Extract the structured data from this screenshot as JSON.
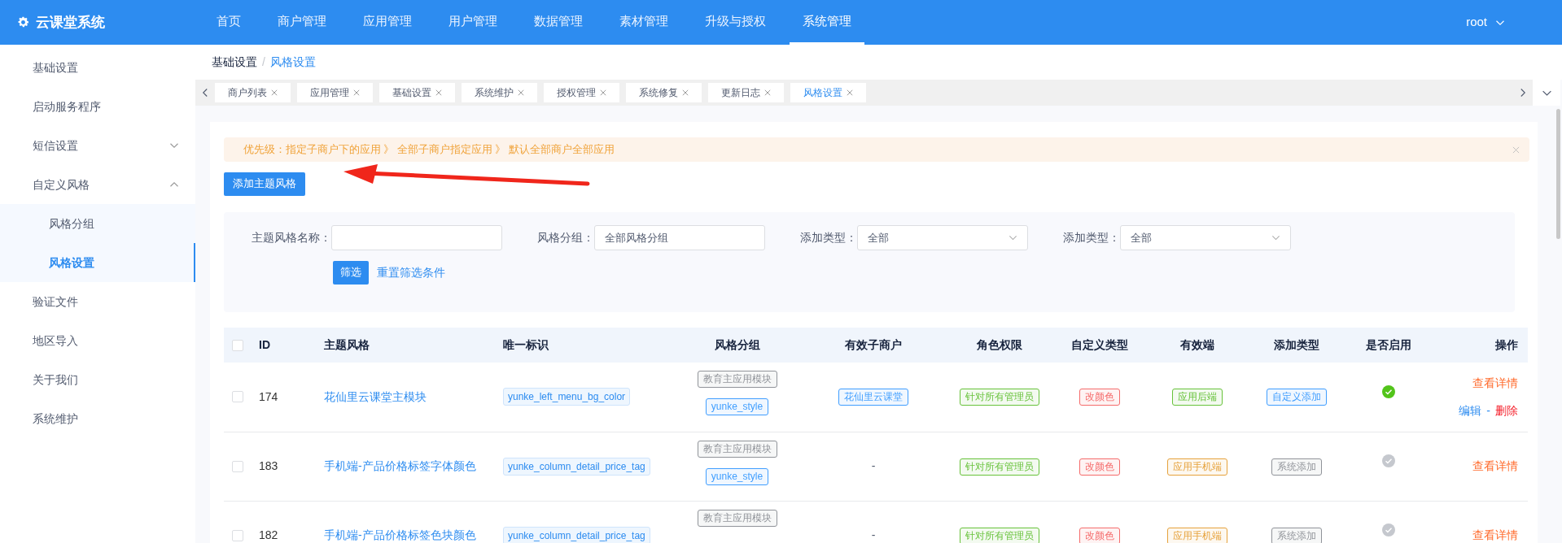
{
  "app": {
    "title": "云课堂系统",
    "user": "root"
  },
  "nav": [
    {
      "label": "首页",
      "selected": false
    },
    {
      "label": "商户管理",
      "selected": false
    },
    {
      "label": "应用管理",
      "selected": false
    },
    {
      "label": "用户管理",
      "selected": false
    },
    {
      "label": "数据管理",
      "selected": false
    },
    {
      "label": "素材管理",
      "selected": false
    },
    {
      "label": "升级与授权",
      "selected": false
    },
    {
      "label": "系统管理",
      "selected": true
    }
  ],
  "sidebar": [
    {
      "label": "基础设置",
      "selected": false
    },
    {
      "label": "启动服务程序",
      "selected": false
    },
    {
      "label": "短信设置",
      "selected": false,
      "expanded": false
    },
    {
      "label": "自定义风格",
      "selected": false,
      "expanded": true,
      "children": [
        {
          "label": "风格分组",
          "selected": false
        },
        {
          "label": "风格设置",
          "selected": true
        }
      ]
    },
    {
      "label": "验证文件",
      "selected": false
    },
    {
      "label": "地区导入",
      "selected": false
    },
    {
      "label": "关于我们",
      "selected": false
    },
    {
      "label": "系统维护",
      "selected": false
    }
  ],
  "breadcrumb": [
    {
      "label": "基础设置",
      "current": false
    },
    {
      "label": "风格设置",
      "current": true
    }
  ],
  "breadcrumb_separator": "/",
  "tabs": [
    {
      "label": "商户列表",
      "selected": false
    },
    {
      "label": "应用管理",
      "selected": false
    },
    {
      "label": "基础设置",
      "selected": false
    },
    {
      "label": "系统维护",
      "selected": false
    },
    {
      "label": "授权管理",
      "selected": false
    },
    {
      "label": "系统修复",
      "selected": false
    },
    {
      "label": "更新日志",
      "selected": false
    },
    {
      "label": "风格设置",
      "selected": true
    }
  ],
  "alert": "优先级：指定子商户下的应用 》 全部子商户指定应用 》 默认全部商户全部应用",
  "add_button": "添加主题风格",
  "filters": [
    {
      "label": "主题风格名称：",
      "kind": "input"
    },
    {
      "label": "风格分组：",
      "kind": "input",
      "value": "全部风格分组"
    },
    {
      "label": "添加类型：",
      "kind": "select",
      "value": "全部"
    },
    {
      "label": "添加类型：",
      "kind": "select",
      "value": "全部"
    }
  ],
  "filter_button": "筛选",
  "reset_link": "重置筛选条件",
  "table": {
    "select_all": {
      "checked": false
    },
    "columns": [
      "ID",
      "主题风格",
      "唯一标识",
      "风格分组",
      "有效子商户",
      "角色权限",
      "自定义类型",
      "有效端",
      "添加类型",
      "是否启用",
      "操作"
    ],
    "rows": [
      {
        "checked": false,
        "id": "174",
        "name": "花仙里云课堂主模块",
        "key": "yunke_left_menu_bg_color",
        "groups": [
          {
            "text": "教育主应用模块",
            "color": "#909399"
          },
          {
            "text": "yunke_style",
            "color": "#409eff"
          }
        ],
        "merchant": {
          "kind": "tag",
          "text": "花仙里云课堂",
          "color": "#409eff"
        },
        "role": {
          "text": "针对所有管理员",
          "color": "#67c23a"
        },
        "custom_type": {
          "text": "改颜色",
          "color": "#f56c6c"
        },
        "platform": {
          "text": "应用后端",
          "color": "#67c23a"
        },
        "add_type": {
          "text": "自定义添加",
          "color": "#409eff"
        },
        "enabled": true,
        "actions": [
          [
            {
              "text": "查看详情",
              "kind": "view"
            }
          ],
          [
            {
              "text": "编辑",
              "kind": "edit"
            },
            {
              "text": "-",
              "kind": "separator"
            },
            {
              "text": "删除",
              "kind": "delete"
            }
          ]
        ]
      },
      {
        "checked": false,
        "id": "183",
        "name": "手机端-产品价格标签字体颜色",
        "key": "yunke_column_detail_price_tag",
        "groups": [
          {
            "text": "教育主应用模块",
            "color": "#909399"
          },
          {
            "text": "yunke_style",
            "color": "#409eff"
          }
        ],
        "merchant": {
          "kind": "text",
          "text": "-"
        },
        "role": {
          "text": "针对所有管理员",
          "color": "#67c23a"
        },
        "custom_type": {
          "text": "改颜色",
          "color": "#f56c6c"
        },
        "platform": {
          "text": "应用手机端",
          "color": "#e6a23c"
        },
        "add_type": {
          "text": "系统添加",
          "color": "#909399"
        },
        "enabled": false,
        "actions": [
          [
            {
              "text": "查看详情",
              "kind": "view"
            }
          ]
        ]
      },
      {
        "checked": false,
        "id": "182",
        "name": "手机端-产品价格标签色块颜色",
        "key": "yunke_column_detail_price_tag",
        "groups": [
          {
            "text": "教育主应用模块",
            "color": "#909399"
          }
        ],
        "merchant": {
          "kind": "text",
          "text": "-"
        },
        "role": {
          "text": "针对所有管理员",
          "color": "#67c23a"
        },
        "custom_type": {
          "text": "改颜色",
          "color": "#f56c6c"
        },
        "platform": {
          "text": "应用手机端",
          "color": "#e6a23c"
        },
        "add_type": {
          "text": "系统添加",
          "color": "#909399"
        },
        "enabled": false,
        "actions": [
          [
            {
              "text": "查看详情",
              "kind": "view"
            }
          ]
        ]
      }
    ]
  }
}
